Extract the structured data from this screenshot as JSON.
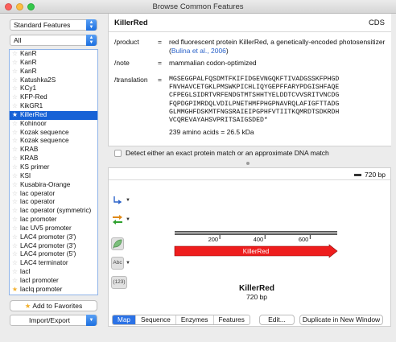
{
  "window": {
    "title": "Browse Common Features"
  },
  "left": {
    "collection_select": "Standard Features",
    "filter_select": "All",
    "items": [
      {
        "label": "KanR",
        "fav": false
      },
      {
        "label": "KanR",
        "fav": false
      },
      {
        "label": "KanR",
        "fav": false
      },
      {
        "label": "Katushka2S",
        "fav": false
      },
      {
        "label": "KCy1",
        "fav": false
      },
      {
        "label": "KFP-Red",
        "fav": false
      },
      {
        "label": "KikGR1",
        "fav": false
      },
      {
        "label": "KillerRed",
        "fav": true
      },
      {
        "label": "Kohinoor",
        "fav": false
      },
      {
        "label": "Kozak sequence",
        "fav": false
      },
      {
        "label": "Kozak sequence",
        "fav": false
      },
      {
        "label": "KRAB",
        "fav": false
      },
      {
        "label": "KRAB",
        "fav": false
      },
      {
        "label": "KS primer",
        "fav": false
      },
      {
        "label": "KSI",
        "fav": false
      },
      {
        "label": "Kusabira-Orange",
        "fav": false
      },
      {
        "label": "lac operator",
        "fav": false
      },
      {
        "label": "lac operator",
        "fav": false
      },
      {
        "label": "lac operator (symmetric)",
        "fav": false
      },
      {
        "label": "lac promoter",
        "fav": false
      },
      {
        "label": "lac UV5 promoter",
        "fav": false
      },
      {
        "label": "LAC4 promoter (3')",
        "fav": false
      },
      {
        "label": "LAC4 promoter (3')",
        "fav": false
      },
      {
        "label": "LAC4 promoter (5')",
        "fav": false
      },
      {
        "label": "LAC4 terminator",
        "fav": false
      },
      {
        "label": "lacI",
        "fav": false
      },
      {
        "label": "lacI promoter",
        "fav": false
      },
      {
        "label": "lacIq promoter",
        "fav": true
      }
    ],
    "selected_index": 7,
    "add_favorites_label": "Add to Favorites",
    "import_export_label": "Import/Export"
  },
  "detail": {
    "name": "KillerRed",
    "type": "CDS",
    "product_key": "/product",
    "product_value": "red fluorescent protein KillerRed, a genetically-encoded photosensitizer (",
    "product_link": "Bulina et al., 2006",
    "product_close": ")",
    "note_key": "/note",
    "note_value": "mammalian codon-optimized",
    "translation_key": "/translation",
    "translation_lines": [
      "MGSEGGPALFQSDMTFKIFIDGEVNGQKFTIVADGSSKFPHGD",
      "FNVHAVCETGKLPMSWKPICHLIQYGEPFFARYPDGISHFAQE",
      "CFPEGLSIDRTVRFENDGTMTSHHTYELDDTCVVSRITVNCDG",
      "FQPDGPIMRDQLVDILPNETHMFPHGPNAVRQLAFIGFTTADG",
      "GLMMGHFDSKMTFNGSRAIEIPGPHFVTIITKQMRDTSDKRDH",
      "VCQREVAYAHSVPRITSAIGSDED*"
    ],
    "aa_summary": "239 amino acids  =  26.5 kDa",
    "equals": "=",
    "detect_label": "Detect either an exact protein match or an approximate DNA match"
  },
  "map": {
    "length_label": "720 bp",
    "feature_name": "KillerRed",
    "feature_length": "720 bp",
    "total_bp": 720,
    "ticks": [
      200,
      400,
      600
    ],
    "feature_start": 1,
    "feature_end": 720,
    "feature_color": "#ee1d1d",
    "tool_icons": [
      "split-feature-icon",
      "orf-arrows-icon",
      "leaf-icon",
      "abc-icon",
      "numbers-icon"
    ],
    "abc_label": "Abc",
    "numbers_label": "123"
  },
  "tabs": [
    {
      "label": "Map",
      "active": true
    },
    {
      "label": "Sequence",
      "active": false
    },
    {
      "label": "Enzymes",
      "active": false
    },
    {
      "label": "Features",
      "active": false
    }
  ],
  "buttons": {
    "edit": "Edit...",
    "duplicate": "Duplicate in New Window"
  }
}
